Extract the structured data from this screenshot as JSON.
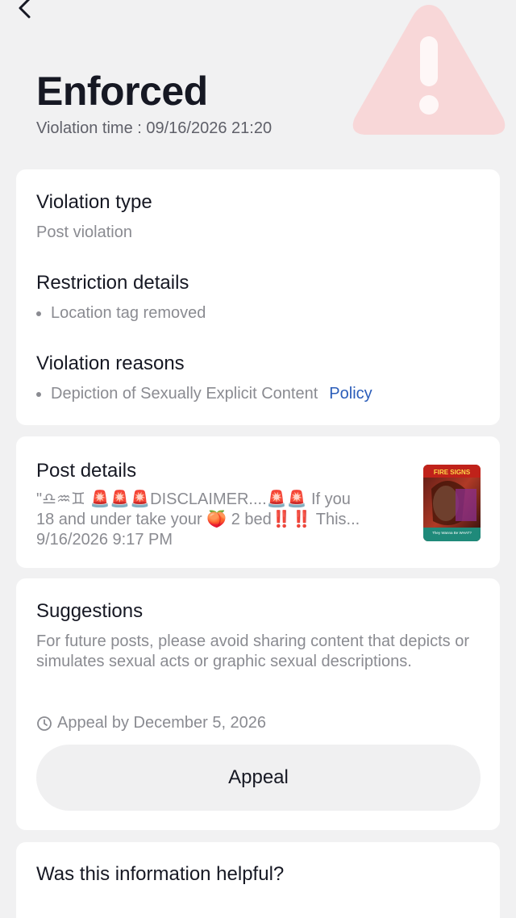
{
  "header": {
    "status_title": "Enforced",
    "violation_time": "Violation time : 09/16/2026 21:20"
  },
  "summary": {
    "violation_type_heading": "Violation type",
    "violation_type_value": "Post violation",
    "restriction_heading": "Restriction details",
    "restriction_items": [
      "Location tag removed"
    ],
    "reasons_heading": "Violation reasons",
    "reason_items": [
      "Depiction of Sexually Explicit Content"
    ],
    "policy_link": "Policy"
  },
  "post": {
    "heading": "Post details",
    "caption_line1": "\"♎♒♊ 🚨🚨🚨DISCLAIMER....🚨🚨 If you",
    "caption_line2": "18 and under take your 🍑 2 bed‼️‼️ This...",
    "posted_at": "9/16/2026 9:17 PM",
    "thumb_title": "FIRE SIGNS",
    "thumb_footer": "They Wanna Be WHAT?"
  },
  "suggestions": {
    "heading": "Suggestions",
    "text": "For future posts, please avoid sharing content that depicts or simulates sexual acts or graphic sexual descriptions.",
    "appeal_deadline": "Appeal by December 5, 2026",
    "appeal_button": "Appeal"
  },
  "feedback": {
    "question": "Was this information helpful?"
  },
  "colors": {
    "background": "#f1f1f2",
    "card": "#ffffff",
    "link": "#2b5db9",
    "warning": "#f6b6b9"
  },
  "icons": {
    "back": "chevron-left-icon",
    "warning": "warning-triangle-icon",
    "clock": "clock-icon"
  }
}
